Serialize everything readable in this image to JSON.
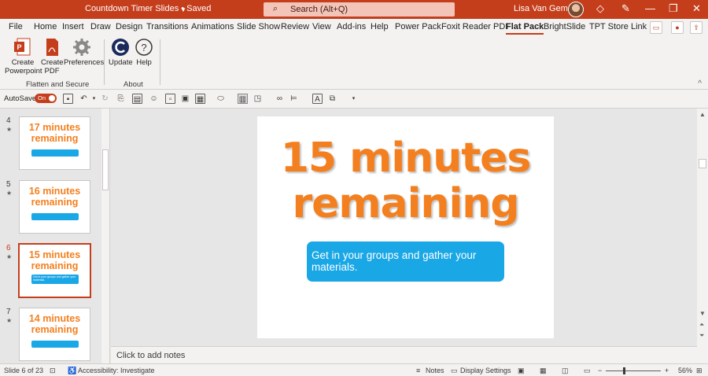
{
  "window": {
    "doc_title": "Countdown Timer Slides • Saved",
    "search_placeholder": "Search (Alt+Q)",
    "user_name": "Lisa Van Gemert",
    "brand_color": "#c43e1c"
  },
  "menu": {
    "tabs": [
      "File",
      "Home",
      "Insert",
      "Draw",
      "Design",
      "Transitions",
      "Animations",
      "Slide Show",
      "Review",
      "View",
      "Add-ins",
      "Help",
      "Power Pack",
      "Foxit Reader PDF",
      "Flat Pack",
      "BrightSlide",
      "TPT Store Link"
    ],
    "active_tab": "Flat Pack"
  },
  "ribbon": {
    "buttons": {
      "create_powerpoint": [
        "Create",
        "Powerpoint"
      ],
      "create_pdf": [
        "Create",
        "PDF"
      ],
      "preferences": "Preferences",
      "update": "Update",
      "help": "Help"
    },
    "groups": {
      "flatten": "Flatten and Secure",
      "about": "About"
    }
  },
  "qat": {
    "autosave_label": "AutoSave",
    "autosave_state": "On"
  },
  "thumbnails": [
    {
      "num": "4",
      "line1": "17 minutes",
      "line2": "remaining",
      "active": false
    },
    {
      "num": "5",
      "line1": "16 minutes",
      "line2": "remaining",
      "active": false
    },
    {
      "num": "6",
      "line1": "15 minutes",
      "line2": "remaining",
      "active": true
    },
    {
      "num": "7",
      "line1": "14 minutes",
      "line2": "remaining",
      "active": false
    }
  ],
  "slide": {
    "title_line1": "15 minutes",
    "title_line2": "remaining",
    "callout": "Get in your groups and gather your materials.",
    "title_color": "#f47f1e",
    "callout_color": "#1aa7e6"
  },
  "notes_placeholder": "Click to add notes",
  "status": {
    "slide_counter": "Slide 6 of 23",
    "accessibility": "Accessibility: Investigate",
    "notes": "Notes",
    "display_settings": "Display Settings",
    "zoom": "56%"
  }
}
